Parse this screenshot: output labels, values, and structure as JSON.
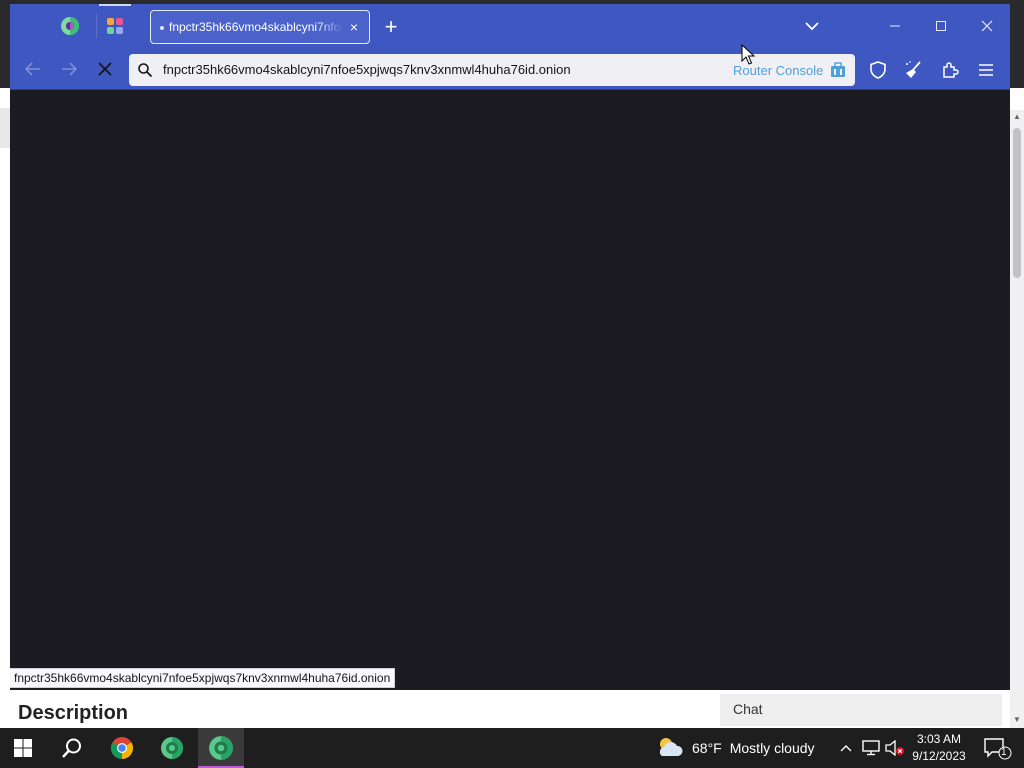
{
  "browser": {
    "tab": {
      "title": "fnpctr35hk66vmo4skablcyni7nfoe5xpjwqs7knv3xnmwl4huha76id.onion",
      "close_glyph": "×"
    },
    "new_tab_glyph": "+",
    "url": "fnpctr35hk66vmo4skablcyni7nfoe5xpjwqs7knv3xnmwl4huha76id.onion",
    "router_console_label": "Router Console",
    "status_url": "fnpctr35hk66vmo4skablcyni7nfoe5xpjwqs7knv3xnmwl4huha76id.onion",
    "colors": {
      "toolbar": "#3f57c0",
      "content": "#1c1b22",
      "router_console": "#4f9fd8"
    }
  },
  "background_page": {
    "description_heading": "Description",
    "chat_label": "Chat"
  },
  "taskbar": {
    "weather": {
      "temp": "68°F",
      "condition": "Mostly cloudy"
    },
    "clock": {
      "time": "3:03 AM",
      "date": "9/12/2023"
    },
    "notification_count": "1",
    "apps": [
      "windows-start",
      "search",
      "chrome",
      "tor-browser",
      "tor-browser-active"
    ]
  }
}
